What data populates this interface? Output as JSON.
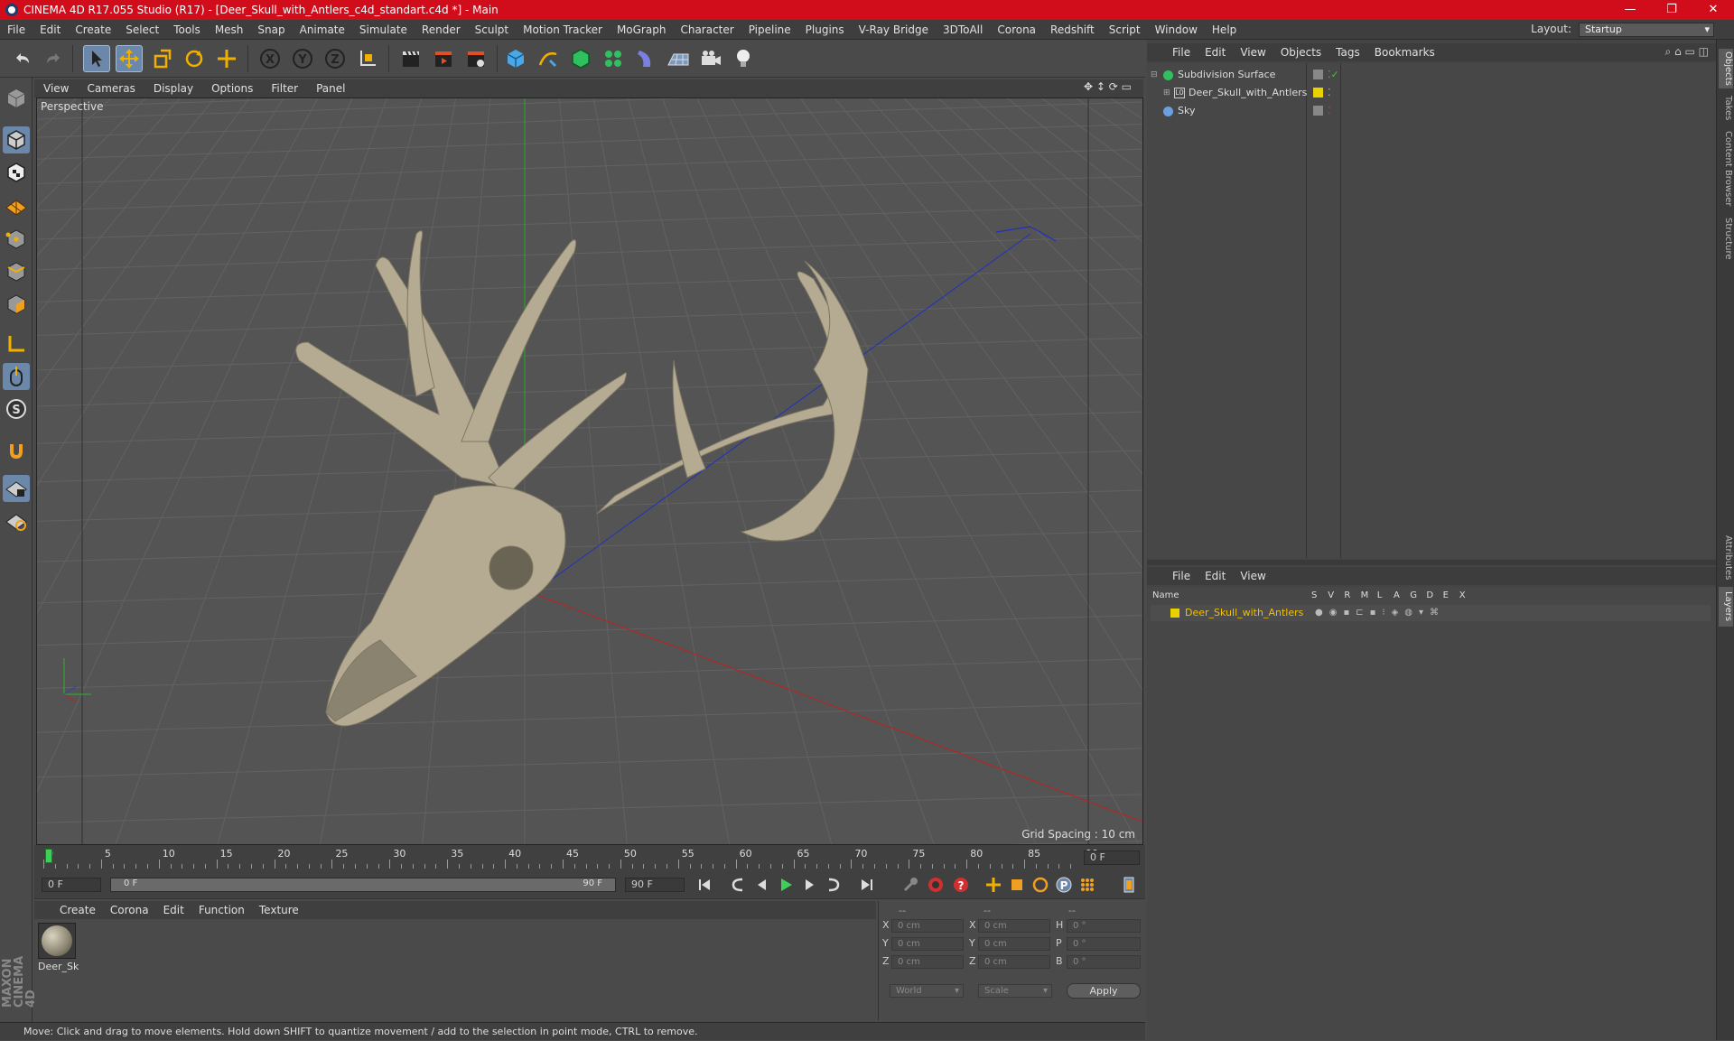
{
  "window": {
    "title": "CINEMA 4D R17.055 Studio (R17) - [Deer_Skull_with_Antlers_c4d_standart.c4d *] - Main",
    "minimize": "—",
    "restore": "❐",
    "close": "✕"
  },
  "menu": [
    "File",
    "Edit",
    "Create",
    "Select",
    "Tools",
    "Mesh",
    "Snap",
    "Animate",
    "Simulate",
    "Render",
    "Sculpt",
    "Motion Tracker",
    "MoGraph",
    "Character",
    "Pipeline",
    "Plugins",
    "V-Ray Bridge",
    "3DToAll",
    "Corona",
    "Redshift",
    "Script",
    "Window",
    "Help"
  ],
  "layout": {
    "label": "Layout:",
    "value": "Startup"
  },
  "viewport": {
    "menu": [
      "View",
      "Cameras",
      "Display",
      "Options",
      "Filter",
      "Panel"
    ],
    "label": "Perspective",
    "grid_spacing": "Grid Spacing : 10 cm"
  },
  "timeline": {
    "ticks": [
      "0",
      "5",
      "10",
      "15",
      "20",
      "25",
      "30",
      "35",
      "40",
      "45",
      "50",
      "55",
      "60",
      "65",
      "70",
      "75",
      "80",
      "85",
      "90"
    ],
    "current_frame": "0 F",
    "start": "0 F",
    "range_start": "0 F",
    "range_end": "90 F",
    "end": "90 F"
  },
  "materials": {
    "menu": [
      "Create",
      "Corona",
      "Edit",
      "Function",
      "Texture"
    ],
    "items": [
      {
        "name": "Deer_Sk"
      }
    ]
  },
  "coords": {
    "headers": [
      "--",
      "--",
      "--"
    ],
    "rows": [
      {
        "axis": "X",
        "pos": "0 cm",
        "axis2": "X",
        "size": "0 cm",
        "rot_axis": "H",
        "rot": "0 °"
      },
      {
        "axis": "Y",
        "pos": "0 cm",
        "axis2": "Y",
        "size": "0 cm",
        "rot_axis": "P",
        "rot": "0 °"
      },
      {
        "axis": "Z",
        "pos": "0 cm",
        "axis2": "Z",
        "size": "0 cm",
        "rot_axis": "B",
        "rot": "0 °"
      }
    ],
    "mode": "World",
    "size_mode": "Scale",
    "apply": "Apply"
  },
  "status": "Move: Click and drag to move elements. Hold down SHIFT to quantize movement / add to the selection in point mode, CTRL to remove.",
  "objects": {
    "menu": [
      "File",
      "Edit",
      "View",
      "Objects",
      "Tags",
      "Bookmarks"
    ],
    "items": [
      {
        "name": "Subdivision Surface"
      },
      {
        "name": "Deer_Skull_with_Antlers"
      },
      {
        "name": "Sky"
      }
    ]
  },
  "layers": {
    "menu": [
      "File",
      "Edit",
      "View"
    ],
    "columns": [
      "Name",
      "S",
      "V",
      "R",
      "M",
      "L",
      "A",
      "G",
      "D",
      "E",
      "X"
    ],
    "items": [
      {
        "name": "Deer_Skull_with_Antlers"
      }
    ]
  },
  "side_tabs": [
    "Objects",
    "Takes",
    "Content Browser",
    "Structure",
    "Attributes",
    "Layers"
  ],
  "branding": "MAXON CINEMA 4D",
  "colors": {
    "title_bar": "#d20d1b",
    "selected_tool": "#6b87a9",
    "x_axis": "#c02020",
    "y_axis": "#20b020",
    "z_axis": "#2030c0",
    "layer_color": "#e8d200"
  }
}
